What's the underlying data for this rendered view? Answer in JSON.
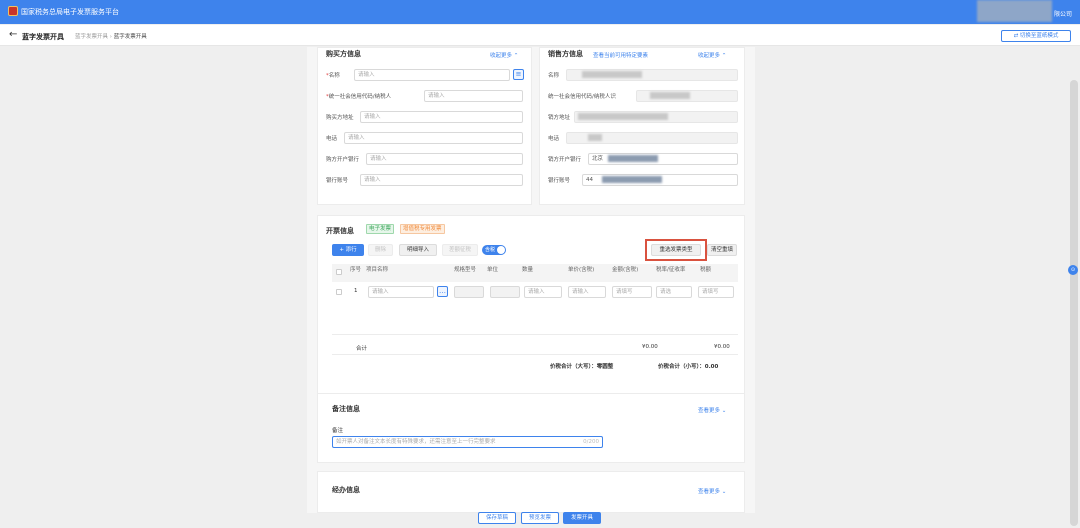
{
  "app": {
    "title": "国家税务总局电子发票服务平台",
    "user_suffix": "限公司"
  },
  "header": {
    "title": "蓝字发票开具",
    "breadcrumb": [
      "蓝字发票开具",
      "蓝字发票开具"
    ],
    "switch_button": "切换至蓝纸模式",
    "back_icon": "arrow-left-icon"
  },
  "buyer": {
    "title": "购买方信息",
    "more": "收起更多 ⌃",
    "fields": [
      {
        "label": "名称",
        "required": true,
        "placeholder": "请输入"
      },
      {
        "label": "统一社会信用代码/纳税人",
        "required": true,
        "placeholder": "请输入"
      },
      {
        "label": "购买方地址",
        "required": false,
        "placeholder": "请输入"
      },
      {
        "label": "电话",
        "required": false,
        "placeholder": "请输入"
      },
      {
        "label": "购方开户银行",
        "required": false,
        "placeholder": "请输入"
      },
      {
        "label": "银行账号",
        "required": false,
        "placeholder": "请输入"
      }
    ],
    "pick_icon": "select-list-icon"
  },
  "seller": {
    "title": "销售方信息",
    "check_link": "查看当前可用特定要素",
    "more": "收起更多 ⌃",
    "fields": [
      {
        "label": "名称",
        "value": ""
      },
      {
        "label": "统一社会信用代码/纳税人识",
        "value": ""
      },
      {
        "label": "销方地址",
        "value": ""
      },
      {
        "label": "电话",
        "value": ""
      },
      {
        "label": "销方开户银行",
        "value": "北京"
      },
      {
        "label": "银行账号",
        "value": "44"
      }
    ]
  },
  "invoice": {
    "title": "开票信息",
    "tag_electronic": "电子发票",
    "tag_type": "增值税专用发票",
    "buttons": {
      "add_row": "+ 添行",
      "delete": "删除",
      "batch_import": "明细导入",
      "price_tax": "差额征税",
      "toggle": "含税",
      "pick_type": "重选发票类型",
      "clear": "清空重填"
    },
    "columns": [
      "序号",
      "项目名称",
      "规格型号",
      "单位",
      "数量",
      "单价(含税)",
      "金额(含税)",
      "税率/征收率",
      "税额"
    ],
    "rows": [
      {
        "index": "1",
        "name_placeholder": "请输入",
        "qty_placeholder": "请输入",
        "price_placeholder": "请输入",
        "amount_placeholder": "请填写",
        "rate_placeholder": "请选",
        "tax_placeholder": "请填写"
      }
    ],
    "total_label": "合计",
    "total_amount": "¥0.00",
    "total_tax": "¥0.00",
    "sum_upper_label": "价税合计（大写）：",
    "sum_upper": "零圆整",
    "sum_lower_label": "价税合计（小写）：",
    "sum_lower": "0.00"
  },
  "remarks": {
    "title": "备注信息",
    "more": "查看更多 ⌄",
    "field_label": "备注",
    "placeholder": "如开票人对备注文本长度有特殊要求，还需注意至上一行完整要求",
    "counter": "0/200"
  },
  "agent": {
    "title": "经办信息",
    "more": "查看更多 ⌄"
  },
  "footer": {
    "save_draft": "保存草稿",
    "preview": "预览发票",
    "issue": "发票开具"
  },
  "float_button": "⊙"
}
